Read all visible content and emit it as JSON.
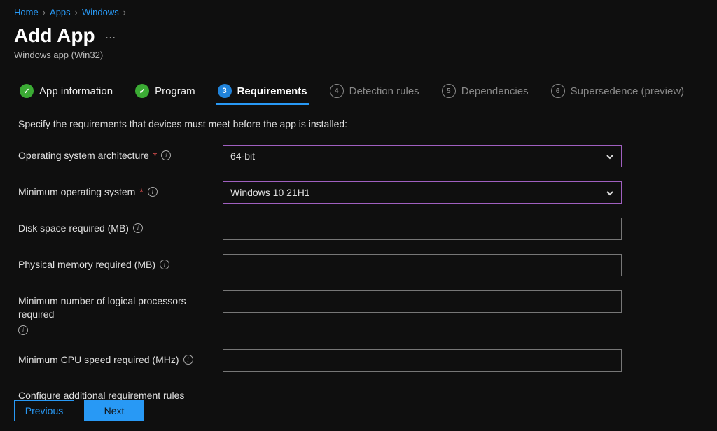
{
  "breadcrumb": {
    "home": "Home",
    "apps": "Apps",
    "windows": "Windows"
  },
  "title": "Add App",
  "subtitle": "Windows app (Win32)",
  "tabs": {
    "appinfo": "App information",
    "program": "Program",
    "requirements": "Requirements",
    "detection": "Detection rules",
    "dependencies": "Dependencies",
    "supersedence": "Supersedence (preview)",
    "num3": "3",
    "num4": "4",
    "num5": "5",
    "num6": "6"
  },
  "intro": "Specify the requirements that devices must meet before the app is installed:",
  "labels": {
    "osArch": "Operating system architecture",
    "minOs": "Minimum operating system",
    "disk": "Disk space required (MB)",
    "mem": "Physical memory required (MB)",
    "cpuCount": "Minimum number of logical processors required",
    "cpuSpeed": "Minimum CPU speed required (MHz)",
    "extra": "Configure additional requirement rules"
  },
  "values": {
    "osArch": "64-bit",
    "minOs": "Windows 10 21H1",
    "disk": "",
    "mem": "",
    "cpuCount": "",
    "cpuSpeed": ""
  },
  "buttons": {
    "previous": "Previous",
    "next": "Next"
  }
}
